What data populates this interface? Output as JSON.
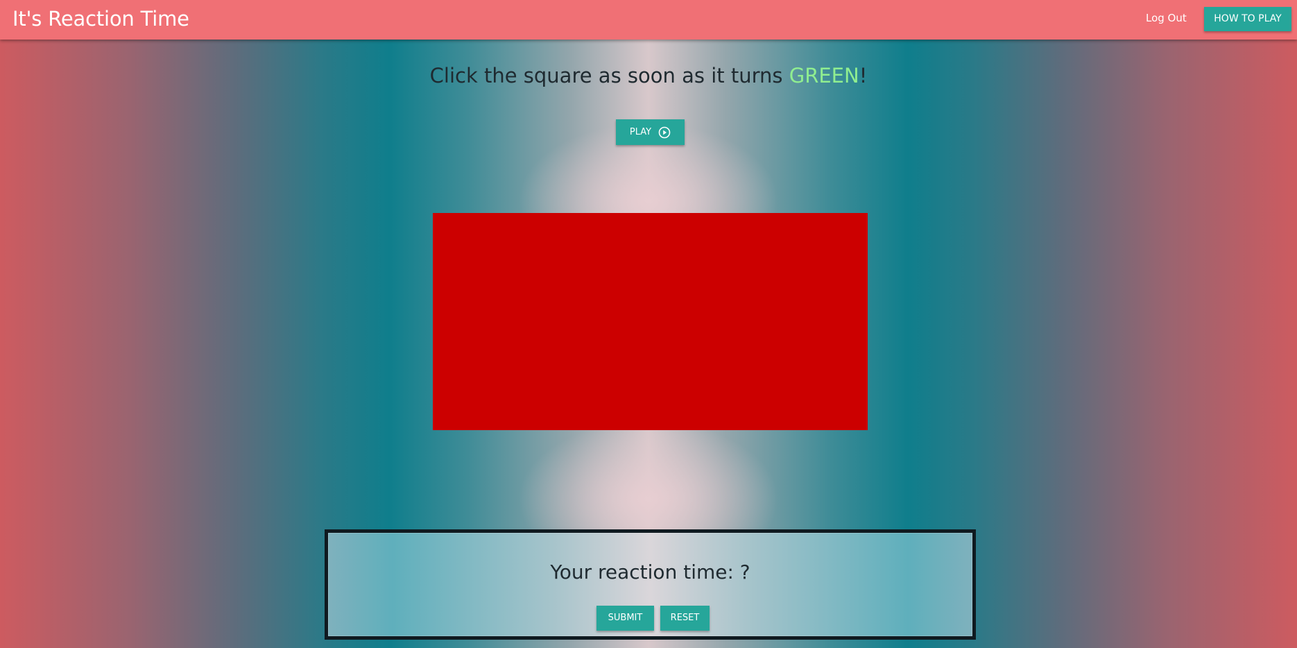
{
  "navbar": {
    "brand": "It's Reaction Time",
    "logout_label": "Log Out",
    "how_to_play_label": "HOW TO PLAY"
  },
  "instruction": {
    "prefix": "Click the square as soon as it turns ",
    "highlight": "GREEN",
    "suffix": "!"
  },
  "play_button": {
    "label": "PLAY",
    "icon": "play-circle-icon"
  },
  "target_square": {
    "color": "#cc0000"
  },
  "result": {
    "text": "Your reaction time: ?",
    "submit_label": "SUBMIT",
    "reset_label": "RESET"
  },
  "colors": {
    "navbar": "#f07075",
    "button": "#26a69a",
    "highlight_green": "#90ee90",
    "square_red": "#cc0000"
  }
}
